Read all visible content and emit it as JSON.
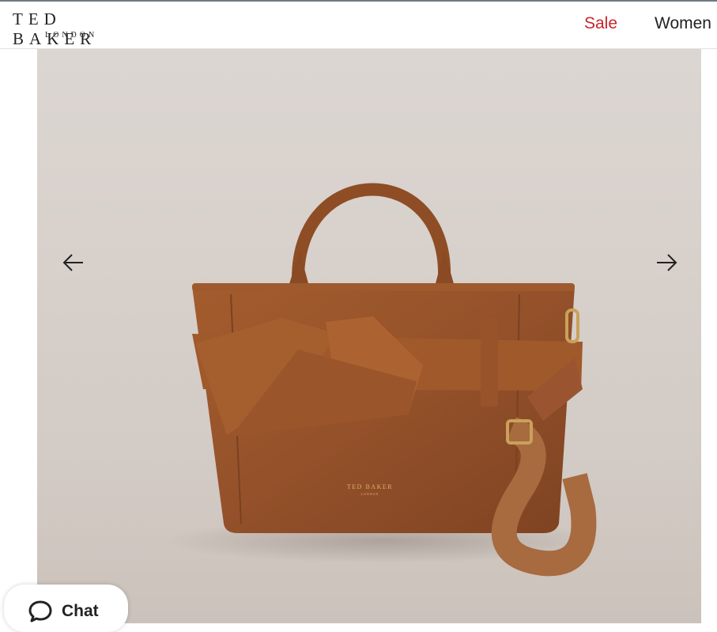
{
  "header": {
    "logo_main": "TED BAKER",
    "logo_sub": "LONDON",
    "nav": [
      {
        "label": "Sale",
        "color": "#c9242b"
      },
      {
        "label": "Women",
        "color": "#222222"
      }
    ]
  },
  "gallery": {
    "product_logo_main": "TED BAKER",
    "product_logo_sub": "LONDON",
    "prev_icon": "arrow-left-icon",
    "next_icon": "arrow-right-icon"
  },
  "chat": {
    "label": "Chat",
    "icon": "chat-bubble-icon"
  }
}
